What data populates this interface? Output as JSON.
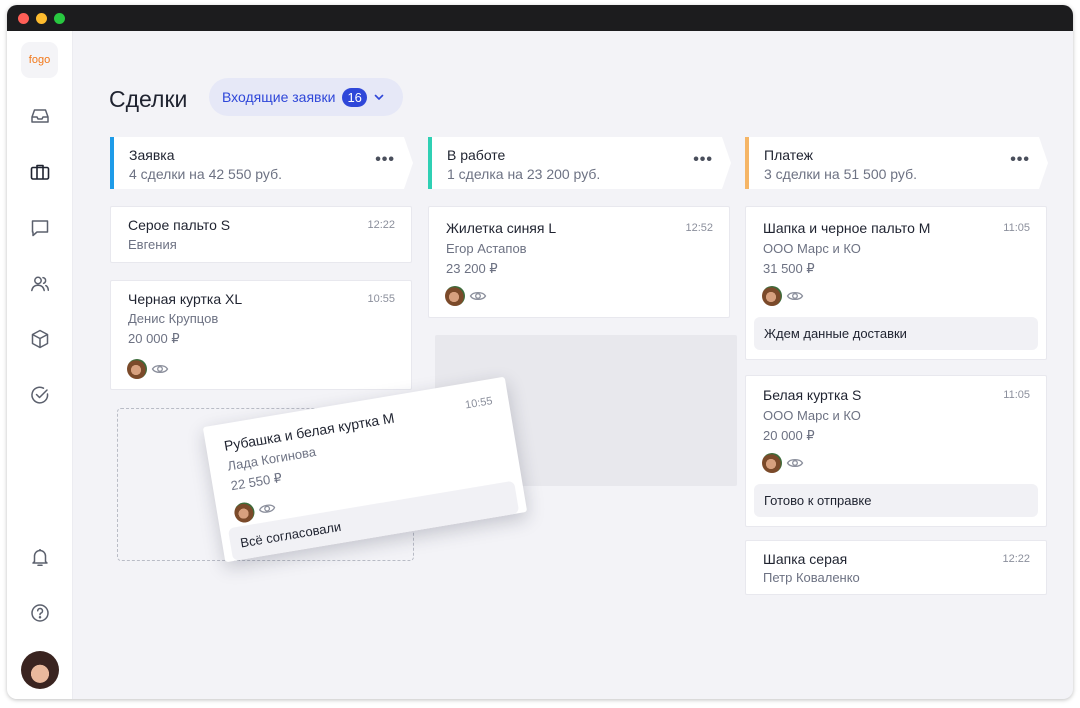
{
  "colors": {
    "accent": "#2f47d9",
    "col_request": "#1e9be8",
    "col_work": "#2fd0b4",
    "col_payment": "#f5b566",
    "logo": "#f2781a"
  },
  "sidebar": {
    "logo": "fogo",
    "icons": [
      "inbox-icon",
      "briefcase-icon",
      "chat-icon",
      "users-icon",
      "box-icon",
      "check-circle-icon",
      "bell-icon",
      "help-icon"
    ]
  },
  "header": {
    "title": "Сделки",
    "filter_label": "Входящие заявки",
    "filter_count": "16"
  },
  "columns": [
    {
      "name": "Заявка",
      "summary": "4 сделки на 42 550 руб.",
      "cards": [
        {
          "title": "Серое пальто S",
          "time": "12:22",
          "client": "Евгения"
        },
        {
          "title": "Черная куртка XL",
          "time": "10:55",
          "client": "Денис Крупцов",
          "price": "20 000 ₽"
        }
      ]
    },
    {
      "name": "В работе",
      "summary": "1 сделка на 23 200 руб.",
      "cards": [
        {
          "title": "Жилетка синяя L",
          "time": "12:52",
          "client": "Егор Астапов",
          "price": "23 200 ₽"
        }
      ]
    },
    {
      "name": "Платеж",
      "summary": "3 сделки на 51 500 руб.",
      "cards": [
        {
          "title": "Шапка и черное пальто M",
          "time": "11:05",
          "client": "ООО Марс и КО",
          "price": "31 500 ₽",
          "note": "Ждем данные доставки"
        },
        {
          "title": "Белая куртка S",
          "time": "11:05",
          "client": "ООО Марс и КО",
          "price": "20 000 ₽",
          "note": "Готово к отправке"
        },
        {
          "title": "Шапка серая",
          "time": "12:22",
          "client": "Петр Коваленко"
        }
      ]
    }
  ],
  "dragging_card": {
    "title": "Рубашка и белая куртка M",
    "time": "10:55",
    "client": "Лада Когинова",
    "price": "22 550 ₽",
    "note": "Всё согласовали"
  },
  "more_glyph": "•••"
}
